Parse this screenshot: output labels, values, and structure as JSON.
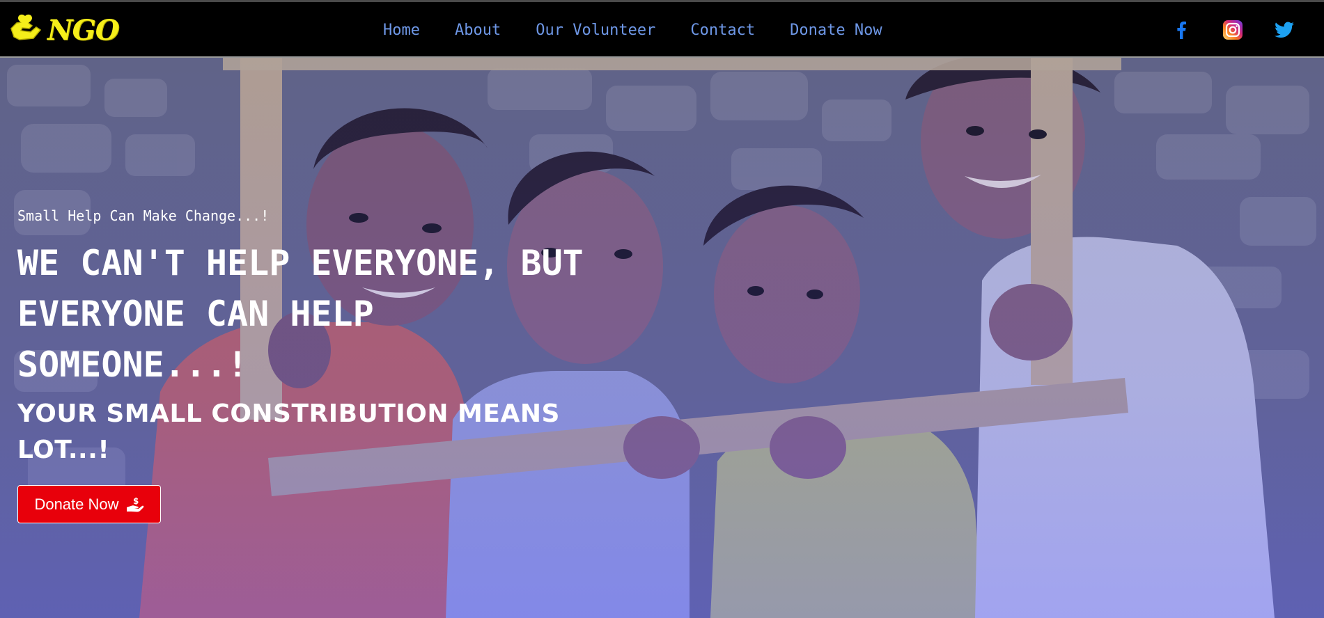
{
  "brand": {
    "logo_text": "NGO"
  },
  "nav": {
    "links": [
      "Home",
      "About",
      "Our Volunteer",
      "Contact",
      "Donate Now"
    ]
  },
  "socials": [
    "facebook-icon",
    "instagram-icon",
    "twitter-icon"
  ],
  "hero": {
    "tagline": "Small Help Can Make Change...!",
    "headline": "WE CAN'T HELP EVERYONE, BUT EVERYONE CAN HELP SOMEONE...!",
    "subheadline": "YOUR SMALL CONSTRIBUTION MEANS LOT...!",
    "button_label": "Donate Now"
  },
  "colors": {
    "navbar_bg": "#000000",
    "nav_link": "#6e97e6",
    "logo": "#f5ee1a",
    "donate_button": "#e8000b",
    "facebook": "#1877f2",
    "twitter": "#1da1f2"
  }
}
